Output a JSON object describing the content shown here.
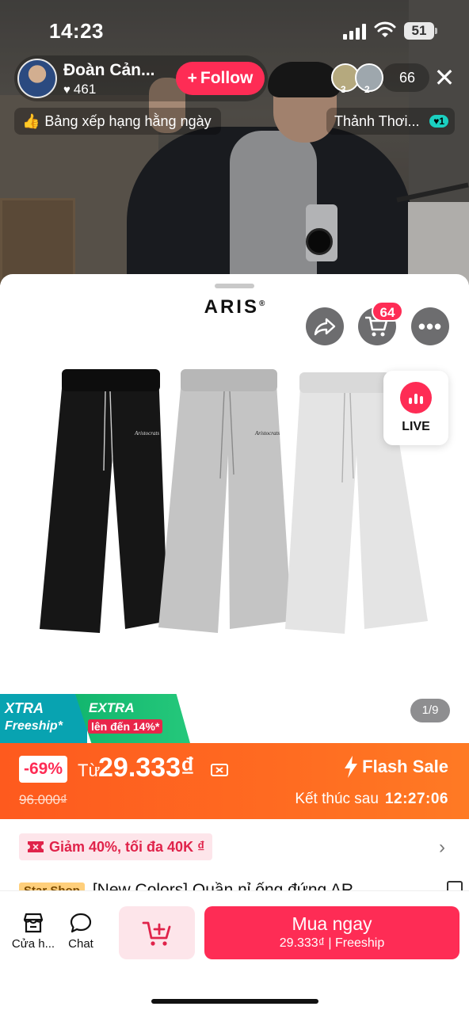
{
  "status_bar": {
    "time": "14:23",
    "battery": "51"
  },
  "host": {
    "name": "Đoàn Cản...",
    "likes": "461",
    "follow_label": "Follow"
  },
  "viewers": {
    "ranks": [
      "3",
      "2"
    ],
    "count": "66"
  },
  "rank_pill": {
    "label": "Bảng xếp hạng hằng ngày"
  },
  "comment_pill": {
    "text": "Thảnh Thơi...",
    "tag": "1"
  },
  "product": {
    "brand": "ARIS",
    "cart_count": "64",
    "live_label": "LIVE",
    "image_counter": "1/9",
    "xtra": {
      "a_top": "XTRA",
      "a_bot": "Freeship*",
      "b_top": "EXTRA",
      "b_bot": "lên đến 14%*"
    },
    "price": {
      "discount": "-69%",
      "from": "Từ",
      "amount": "29.333₫",
      "original": "96.000₫",
      "flash_label": "Flash Sale",
      "ends_label": "Kết thúc sau",
      "countdown": "12:27:06"
    },
    "coupon": "Giảm 40%, tối đa 40K ₫",
    "star_tag": "Star Shop",
    "title": "[New Colors] Quần nỉ ống đứng AR"
  },
  "bottom_bar": {
    "shop_label": "Cửa h...",
    "chat_label": "Chat",
    "buy_label": "Mua ngay",
    "buy_price": "29.333₫",
    "buy_note": "Freeship"
  },
  "colors": {
    "accent": "#fe2c55",
    "price_band": "#ff6b21",
    "xtra_teal": "#08a3b1",
    "extra_green": "#1bb873"
  }
}
